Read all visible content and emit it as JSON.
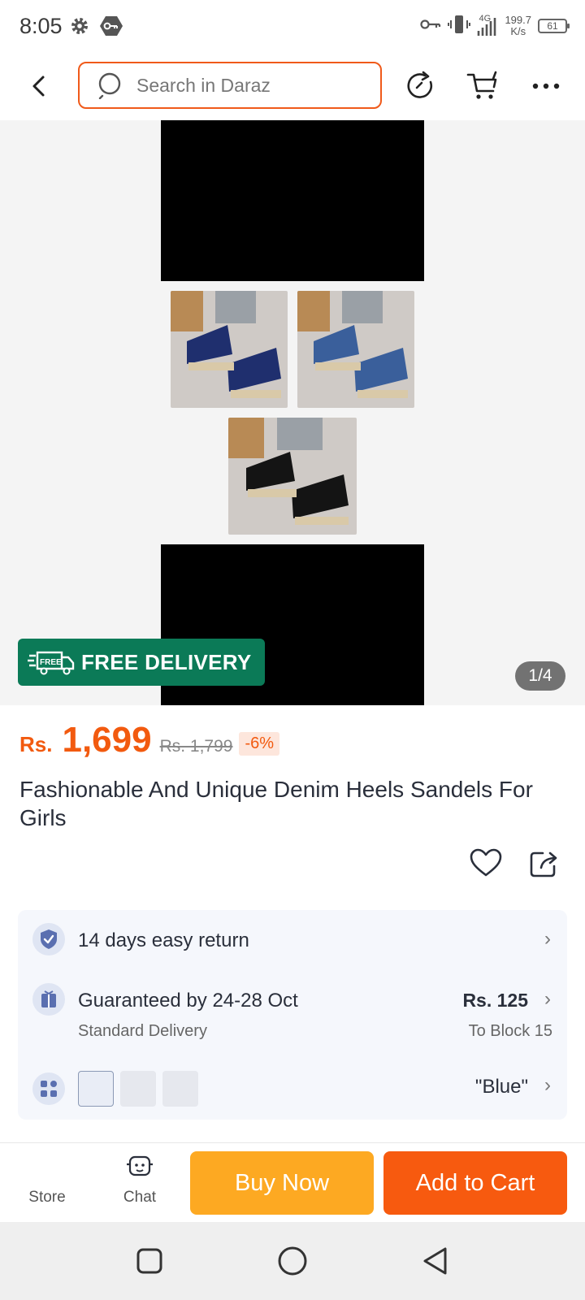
{
  "status_bar": {
    "time": "8:05",
    "network_gen": "4G",
    "net_speed_value": "199.7",
    "net_speed_unit": "K/s",
    "battery": "61",
    "icons": [
      "gear-icon",
      "vpn-key-icon",
      "key-icon",
      "vibrate-icon",
      "signal-icon",
      "battery-icon"
    ]
  },
  "header": {
    "search_placeholder": "Search in Daraz",
    "icons": [
      "back-icon",
      "search-icon",
      "refresh-icon",
      "cart-icon",
      "more-icon"
    ]
  },
  "gallery": {
    "badge": "FREE DELIVERY",
    "badge_truck_text": "FREE",
    "page_indicator": "1/4",
    "thumb_colors": [
      "#1f2f6e",
      "#3a5f9b",
      "#141414"
    ]
  },
  "product": {
    "currency": "Rs.",
    "price": "1,699",
    "original_price": "Rs. 1,799",
    "discount": "-6%",
    "title": "Fashionable And Unique Denim Heels Sandels For Girls"
  },
  "info": {
    "return_text": "14 days easy return",
    "delivery_text": "Guaranteed by 24-28 Oct",
    "delivery_type": "Standard Delivery",
    "shipping_price": "Rs. 125",
    "shipping_dest": "To Block 15",
    "variant_value": "\"Blue\""
  },
  "bottom": {
    "store_label": "Store",
    "chat_label": "Chat",
    "buy_now_label": "Buy Now",
    "add_to_cart_label": "Add to Cart"
  },
  "colors": {
    "accent": "#f75a0f",
    "buy_now": "#fda922",
    "free_delivery": "#0b7a57"
  }
}
